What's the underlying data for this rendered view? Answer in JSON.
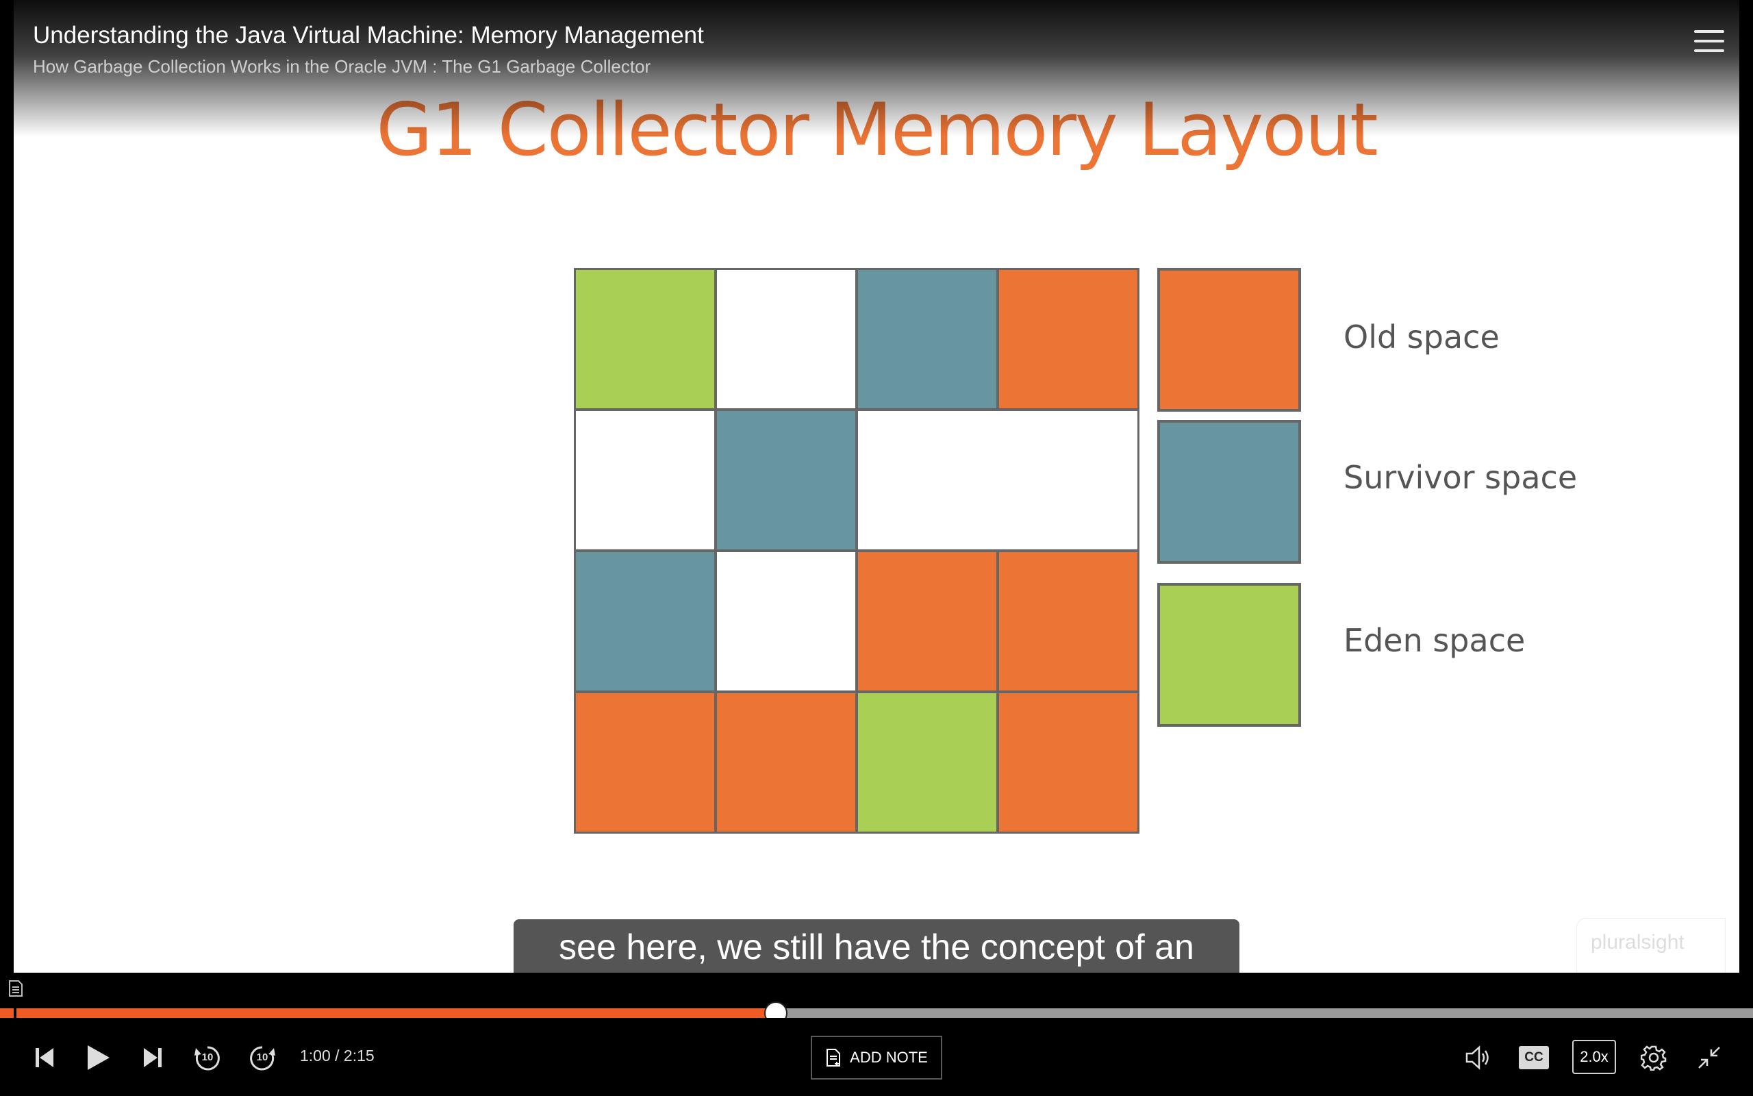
{
  "header": {
    "course_title": "Understanding the Java Virtual Machine: Memory Management",
    "module_title": "How Garbage Collection Works in the Oracle JVM : The G1 Garbage Collector",
    "menu_icon": "hamburger-menu-icon"
  },
  "slide": {
    "title": "G1 Collector Memory Layout",
    "grid_rows": [
      [
        "eden",
        "empty",
        "survivor",
        "old"
      ],
      [
        "empty",
        "survivor",
        "empty-wide"
      ],
      [
        "survivor",
        "empty",
        "old",
        "old"
      ],
      [
        "old",
        "old",
        "eden",
        "old"
      ]
    ],
    "legend": [
      {
        "key": "old",
        "label": "Old space",
        "color": "#ec7434"
      },
      {
        "key": "survivor",
        "label": "Survivor space",
        "color": "#6896a0"
      },
      {
        "key": "eden",
        "label": "Eden space",
        "color": "#a9cf54"
      }
    ],
    "watermark": "pluralsight"
  },
  "caption": {
    "text": "see here, we still have the concept of an"
  },
  "player": {
    "time_display": "1:00 / 2:15",
    "progress_fraction": 0.4425,
    "accent_color": "#f05a24",
    "add_note_label": "ADD NOTE",
    "cc_label": "CC",
    "speed_label": "2.0x",
    "skip_back_label": "10",
    "skip_forward_label": "10",
    "icons": [
      "transcript-icon",
      "previous-icon",
      "play-icon",
      "next-icon",
      "rewind-10-icon",
      "forward-10-icon",
      "note-icon",
      "volume-icon",
      "settings-gear-icon",
      "exit-fullscreen-icon"
    ]
  }
}
